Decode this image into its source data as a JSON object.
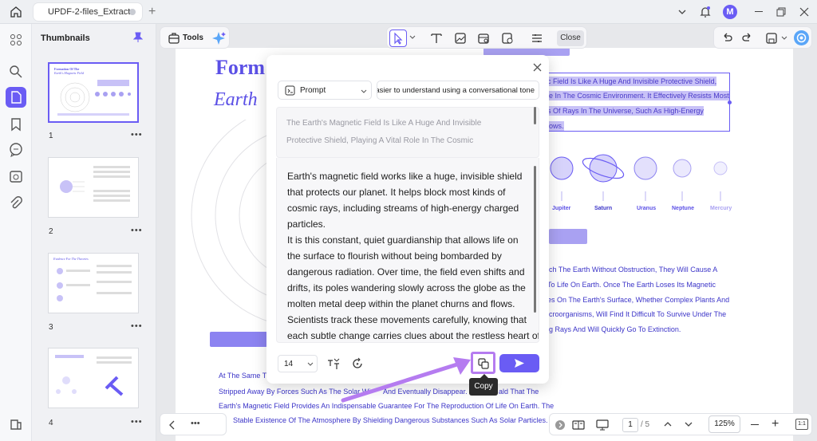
{
  "tab": {
    "title": "UPDF-2-files_Extract"
  },
  "user": {
    "initial": "M"
  },
  "thumbnails": {
    "title": "Thumbnails",
    "pages": [
      {
        "number": "1",
        "heading": "Formation Of The Earth's Magnetic Field"
      },
      {
        "number": "2",
        "heading": ""
      },
      {
        "number": "3",
        "heading": "Evidence For The Theories"
      },
      {
        "number": "4",
        "heading": ""
      }
    ]
  },
  "toolbar": {
    "tools_label": "Tools",
    "close_label": "Close"
  },
  "pdf": {
    "title": "Form",
    "subtitle": "Earth",
    "selected_lines": [
      "c Field Is Like A Huge And Invisible Protective Shield,",
      "le In The Cosmic Environment. It Effectively Resists Most",
      "s Of Rays In The Universe, Such As High-Energy",
      "lows."
    ],
    "planets": [
      "Jupiter",
      "Saturn",
      "Uranus",
      "Neptune",
      "Mercury"
    ],
    "right_lines": [
      "ch The Earth Without Obstruction, They Will Cause A",
      "To Life On Earth. Once The Earth Loses Its Magnetic",
      "es On The Earth's Surface, Whether Complex Plants And",
      "croorganisms, Will Find It Difficult To Survive Under The",
      "g Rays And Will Quickly Go To Extinction."
    ],
    "bottom_lines": [
      "At The Same Ti",
      "Stripped Away By Forces Such As The Solar Wi",
      "Earth's Magnetic Field Provides An Indispensable Guarantee For The Reproduction Of Life On Earth. The",
      "Stable Existence Of The Atmosphere By Shielding Dangerous Substances Such As Solar Particles."
    ],
    "bottom_line2_tail": "And Eventually Disappear. It",
    "bottom_line2_tail2": "ald That The"
  },
  "ai_dialog": {
    "prompt_label": "Prompt",
    "prompt_value": "easier to understand using a conversational tone",
    "source_lines": [
      "The Earth's Magnetic Field Is Like A Huge And Invisible",
      "Protective Shield, Playing A Vital Role In The Cosmic"
    ],
    "result_lines": [
      "Earth's magnetic field works like a huge, invisible shield",
      "that protects our planet. It helps block most kinds of",
      "cosmic rays, including streams of high-energy charged",
      "particles.",
      "It is this constant, quiet guardianship that allows life on",
      "the surface to flourish without being bombarded by",
      "dangerous radiation. Over time, the field even shifts and",
      "drifts, its poles wandering slowly across the globe as the",
      "molten metal deep within the planet churns and flows.",
      "Scientists track these movements carefully, knowing that",
      "each subtle change carries clues about the restless heart of"
    ],
    "font_size": "14",
    "copy_tooltip": "Copy"
  },
  "pager": {
    "current": "1",
    "total": "/ 5",
    "zoom": "125%"
  },
  "colors": {
    "accent": "#6a5cf4",
    "highlight": "#b57cf0"
  }
}
